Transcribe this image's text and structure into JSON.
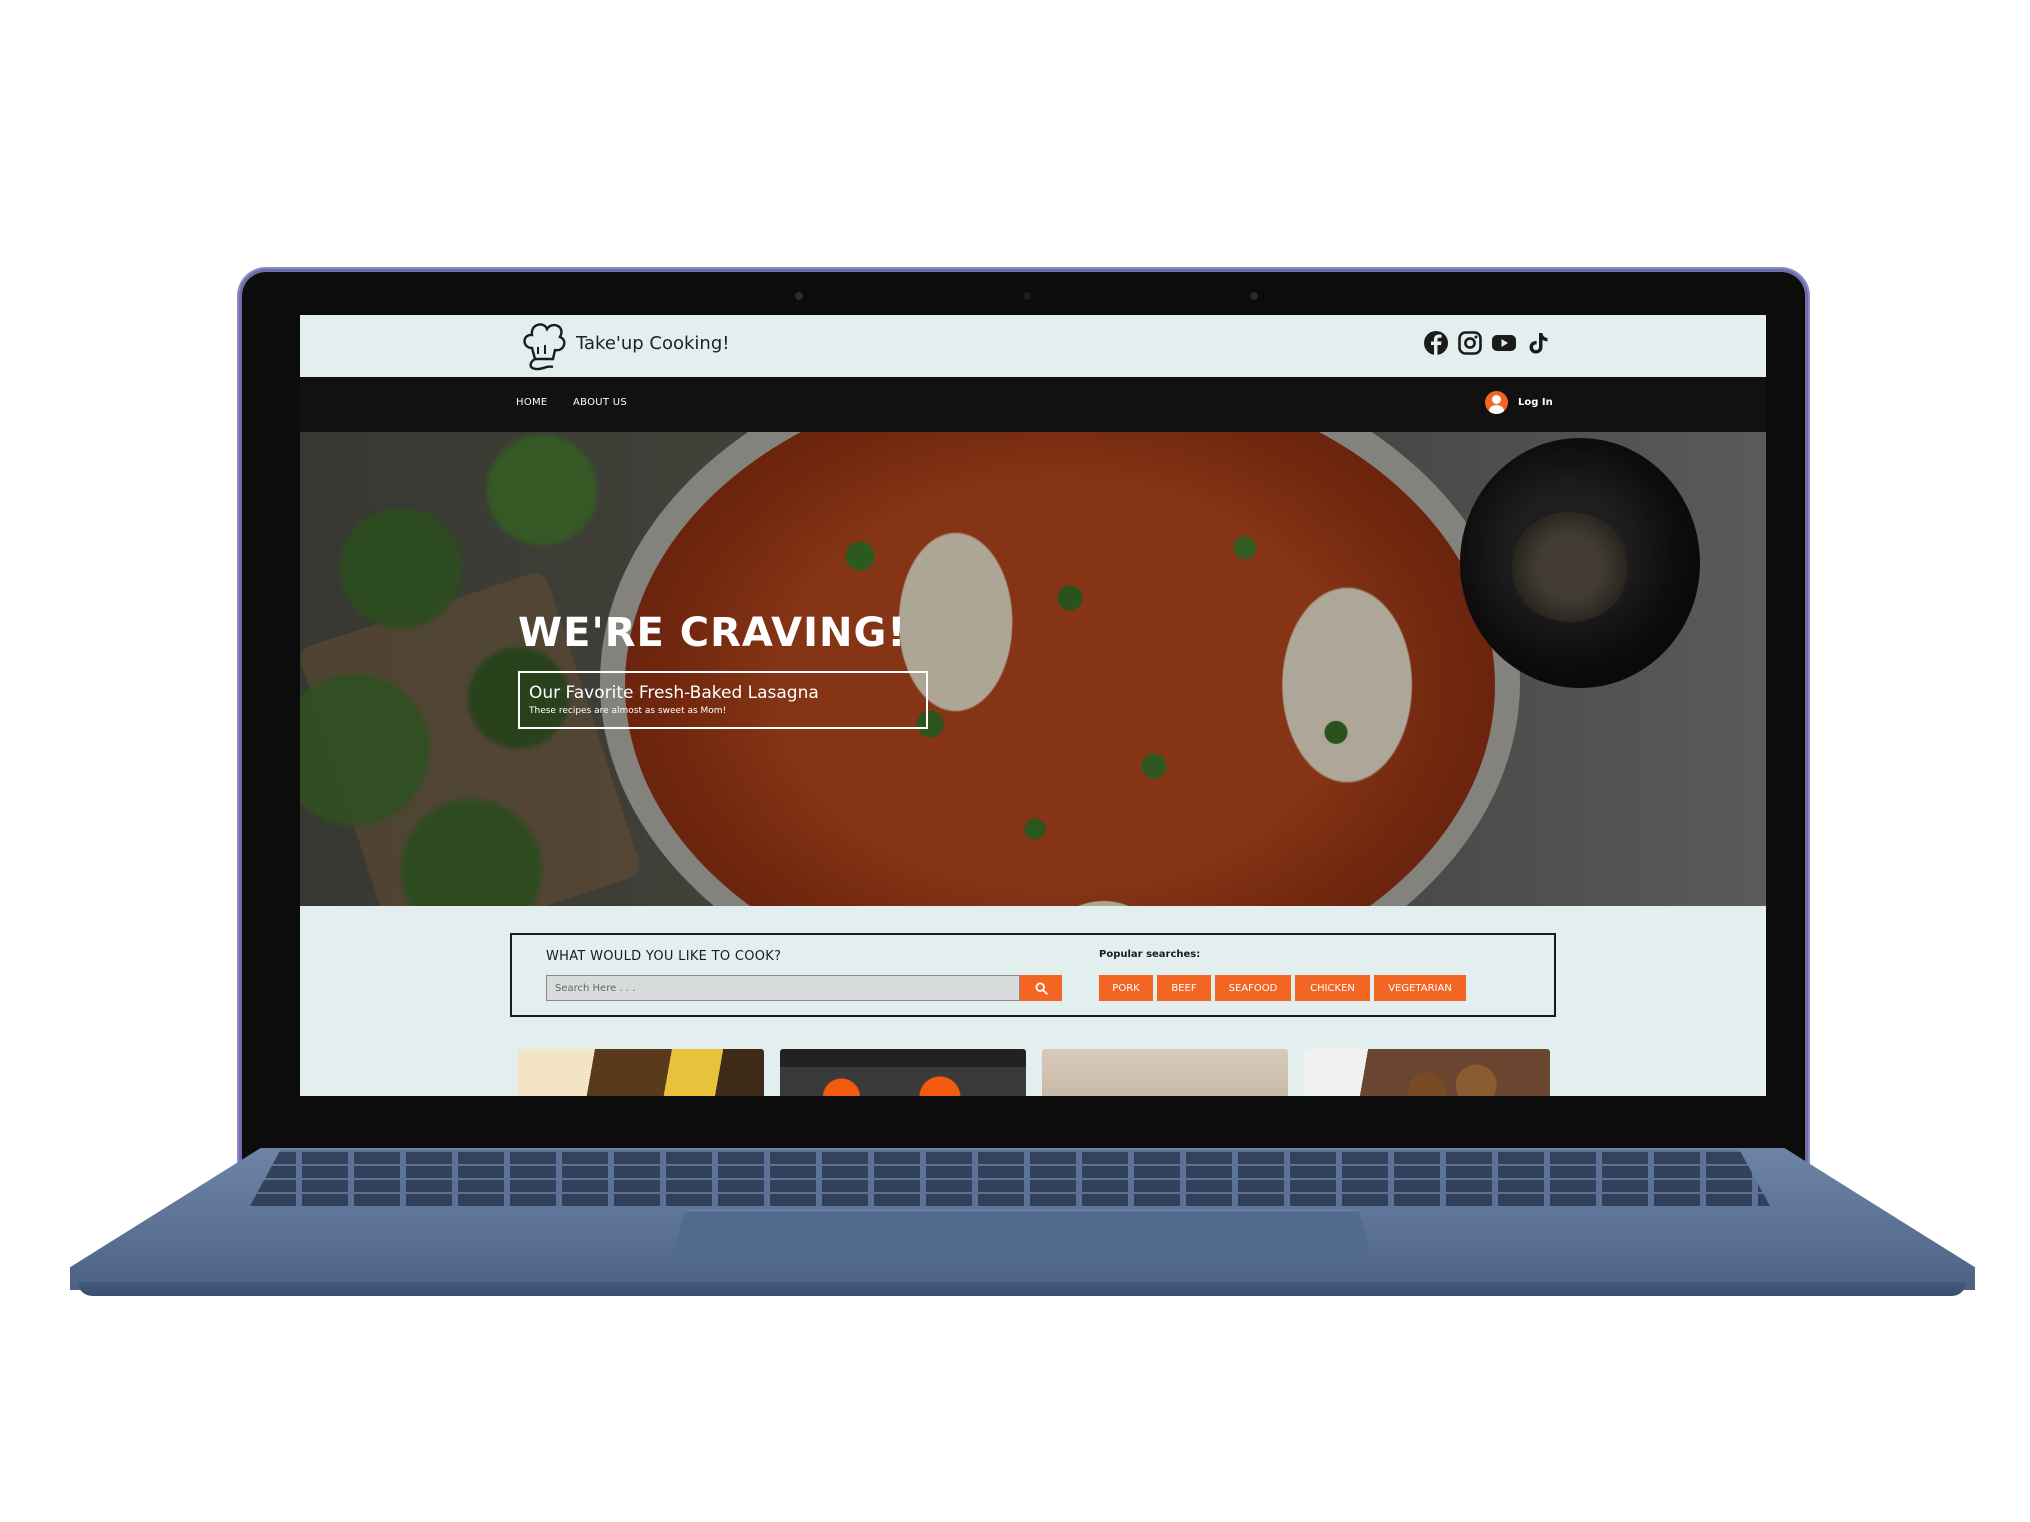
{
  "site": {
    "brand": "Take'up Cooking!",
    "accent_color": "#f26522",
    "nav_bg": "#111111",
    "page_bg": "#e2efee"
  },
  "socials": [
    {
      "icon": "facebook-icon"
    },
    {
      "icon": "instagram-icon"
    },
    {
      "icon": "youtube-icon"
    },
    {
      "icon": "tiktok-icon"
    }
  ],
  "nav": {
    "home": "HOME",
    "about": "ABOUT US",
    "login": "Log In",
    "login_icon": "user-circle-icon"
  },
  "hero": {
    "title": "WE'RE CRAVING!",
    "box_title": "Our Favorite Fresh-Baked Lasagna",
    "box_subtitle": "These recipes are almost as sweet as Mom!"
  },
  "search": {
    "question": "WHAT WOULD YOU LIKE TO COOK?",
    "placeholder": "Search Here . . .",
    "button_icon": "search-icon",
    "popular_label": "Popular searches:",
    "tags": [
      "PORK",
      "BEEF",
      "SEAFOOD",
      "CHICKEN",
      "VEGETARIAN"
    ]
  }
}
